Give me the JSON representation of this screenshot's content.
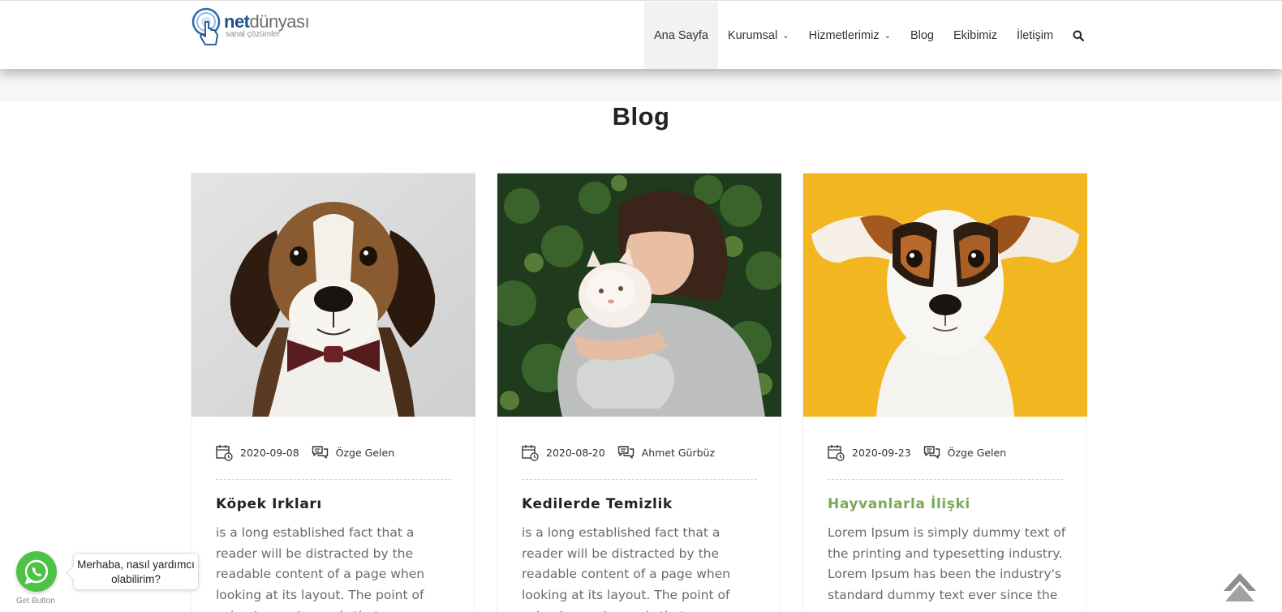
{
  "header": {
    "logo": {
      "name": "netdünyası",
      "brand_bold": "net",
      "brand_light": "dünyası",
      "tagline": "sanal çözümler",
      "colors": {
        "brand": "#1d4f8a",
        "secondary": "#6d6d6d"
      }
    },
    "nav": [
      {
        "label": "Ana Sayfa",
        "active": true,
        "dropdown": false
      },
      {
        "label": "Kurumsal",
        "active": false,
        "dropdown": true
      },
      {
        "label": "Hizmetlerimiz",
        "active": false,
        "dropdown": true
      },
      {
        "label": "Blog",
        "active": false,
        "dropdown": false
      },
      {
        "label": "Ekibimiz",
        "active": false,
        "dropdown": false
      },
      {
        "label": "İletişim",
        "active": false,
        "dropdown": false
      }
    ],
    "search_icon": "search-icon"
  },
  "page": {
    "title": "Blog"
  },
  "posts": [
    {
      "date": "2020-09-08",
      "author": "Özge Gelen",
      "title": "Köpek Irkları",
      "title_color": "#222222",
      "excerpt": "is a long established fact that a reader will be distracted by the readable content of a page when looking at its layout. The point of using Lorem Ipsum is that",
      "image": "beagle-puppy-with-bow-tie"
    },
    {
      "date": "2020-08-20",
      "author": "Ahmet Gürbüz",
      "title": "Kedilerde Temizlik",
      "title_color": "#222222",
      "excerpt": "is a long established fact that a reader will be distracted by the readable content of a page when looking at its layout. The point of using Lorem Ipsum is that",
      "image": "woman-hugging-white-cat"
    },
    {
      "date": "2020-09-23",
      "author": "Özge Gelen",
      "title": "Hayvanlarla İlişki",
      "title_color": "#7aa855",
      "excerpt": "Lorem Ipsum is simply dummy text of the printing and typesetting industry. Lorem Ipsum has been the industry's standard dummy text ever since the",
      "image": "jack-russell-yellow-background"
    }
  ],
  "whatsapp": {
    "bubble_text": "Merhaba, nasıl yardımcı olabilirim?",
    "button_label": "Get Button",
    "color": "#4dc247"
  },
  "scroll_top_icon": "arrow-up-icon"
}
